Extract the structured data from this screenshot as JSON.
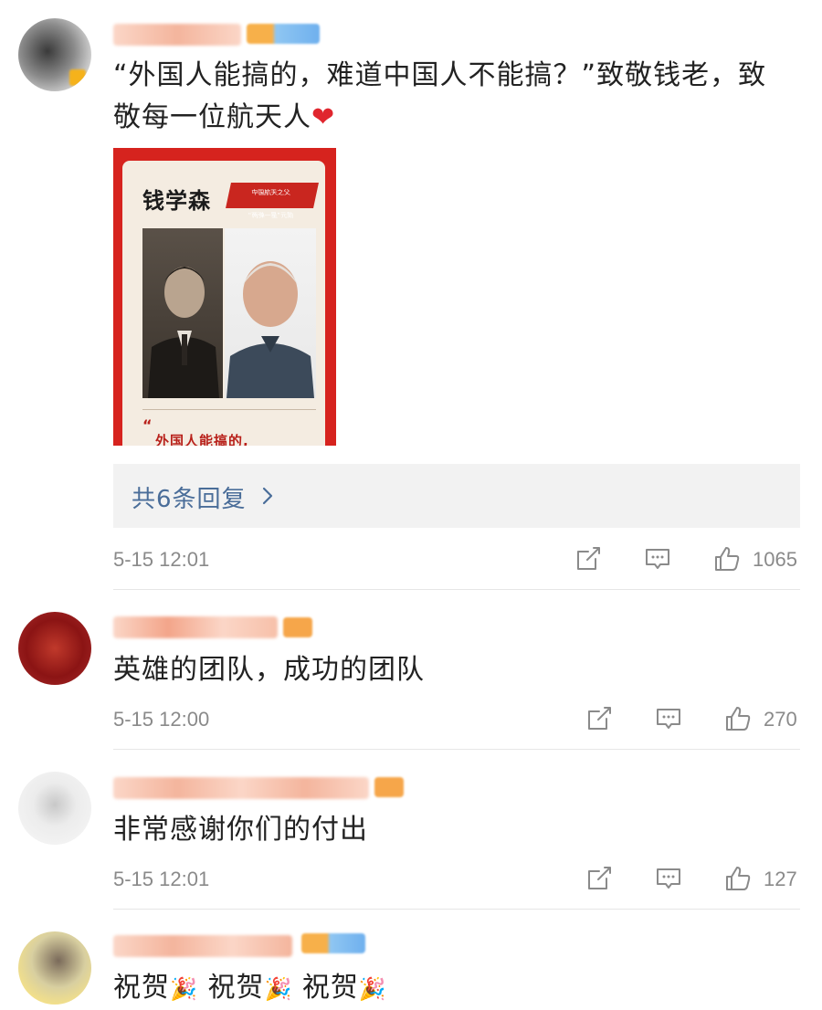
{
  "comments": [
    {
      "text_line1": "“外国人能搞的，难道中国人不能搞？”致敬钱老，致",
      "text_line2": "敬每一位航天人",
      "heart": "❤",
      "card": {
        "name": "钱学森",
        "tag_line1": "中国航天之父",
        "tag_line2": "“两弹一星”元勋",
        "quote_mark": "“",
        "quote": "外国人能搞的,"
      },
      "reply_link": "共6条回复",
      "time": "5-15 12:01",
      "likes": "1065"
    },
    {
      "text": "英雄的团队，成功的团队",
      "time": "5-15 12:00",
      "likes": "270"
    },
    {
      "text": "非常感谢你们的付出",
      "time": "5-15 12:01",
      "likes": "127"
    },
    {
      "word": "祝贺",
      "emoji": "🎉"
    }
  ],
  "icons": {
    "share": "share-icon",
    "comment": "comment-icon",
    "like": "thumbs-up-icon"
  },
  "colors": {
    "link": "#4a6d99",
    "meta": "#8a8a8a",
    "reply_bg": "#f2f2f2",
    "card_red": "#d6231e"
  }
}
